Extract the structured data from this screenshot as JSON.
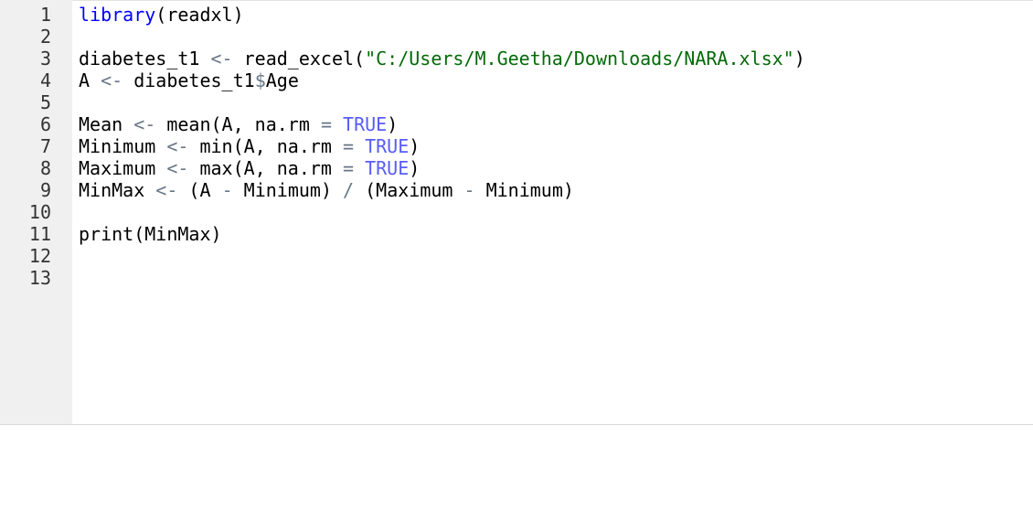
{
  "editor": {
    "line_numbers": [
      "1",
      "2",
      "3",
      "4",
      "5",
      "6",
      "7",
      "8",
      "9",
      "10",
      "11",
      "12",
      "13"
    ],
    "lines": [
      [
        {
          "t": "library",
          "c": "kw"
        },
        {
          "t": "(readxl)",
          "c": "fn"
        }
      ],
      [],
      [
        {
          "t": "diabetes_t1 ",
          "c": "var"
        },
        {
          "t": "<-",
          "c": "op"
        },
        {
          "t": " read_excel(",
          "c": "fn"
        },
        {
          "t": "\"C:/Users/M.Geetha/Downloads/NARA.xlsx\"",
          "c": "str"
        },
        {
          "t": ")",
          "c": "fn"
        }
      ],
      [
        {
          "t": "A ",
          "c": "var"
        },
        {
          "t": "<-",
          "c": "op"
        },
        {
          "t": " diabetes_t1",
          "c": "var"
        },
        {
          "t": "$",
          "c": "op"
        },
        {
          "t": "Age",
          "c": "var"
        }
      ],
      [],
      [
        {
          "t": "Mean ",
          "c": "var"
        },
        {
          "t": "<-",
          "c": "op"
        },
        {
          "t": " mean(A, na.rm ",
          "c": "fn"
        },
        {
          "t": "=",
          "c": "op"
        },
        {
          "t": " ",
          "c": "fn"
        },
        {
          "t": "TRUE",
          "c": "const"
        },
        {
          "t": ")",
          "c": "fn"
        }
      ],
      [
        {
          "t": "Minimum ",
          "c": "var"
        },
        {
          "t": "<-",
          "c": "op"
        },
        {
          "t": " min(A, na.rm ",
          "c": "fn"
        },
        {
          "t": "=",
          "c": "op"
        },
        {
          "t": " ",
          "c": "fn"
        },
        {
          "t": "TRUE",
          "c": "const"
        },
        {
          "t": ")",
          "c": "fn"
        }
      ],
      [
        {
          "t": "Maximum ",
          "c": "var"
        },
        {
          "t": "<-",
          "c": "op"
        },
        {
          "t": " max(A, na.rm ",
          "c": "fn"
        },
        {
          "t": "=",
          "c": "op"
        },
        {
          "t": " ",
          "c": "fn"
        },
        {
          "t": "TRUE",
          "c": "const"
        },
        {
          "t": ")",
          "c": "fn"
        }
      ],
      [
        {
          "t": "MinMax ",
          "c": "var"
        },
        {
          "t": "<-",
          "c": "op"
        },
        {
          "t": " (A ",
          "c": "fn"
        },
        {
          "t": "-",
          "c": "op"
        },
        {
          "t": " Minimum) ",
          "c": "fn"
        },
        {
          "t": "/",
          "c": "op"
        },
        {
          "t": " (Maximum ",
          "c": "fn"
        },
        {
          "t": "-",
          "c": "op"
        },
        {
          "t": " Minimum)",
          "c": "fn"
        }
      ],
      [],
      [
        {
          "t": "print(MinMax)",
          "c": "fn"
        }
      ],
      [],
      []
    ]
  }
}
